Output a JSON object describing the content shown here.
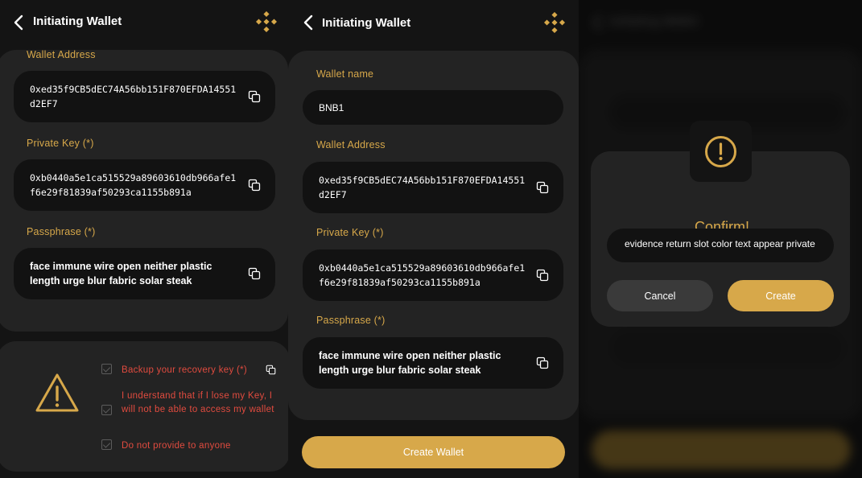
{
  "header": {
    "title": "Initiating Wallet"
  },
  "wallet": {
    "name_label": "Wallet name",
    "name_value": "BNB1",
    "address_label": "Wallet Address",
    "address_value": "0xed35f9CB5dEC74A56bb151F870EFDA14551d2EF7",
    "private_key_label": "Private Key (*)",
    "private_key_value": "0xb0440a5e1ca515529a89603610db966afe1f6e29f81839af50293ca1155b891a",
    "passphrase_label": "Passphrase (*)",
    "passphrase_value": "face immune wire open neither plastic length urge blur fabric solar steak"
  },
  "warnings": [
    "Backup your recovery key (*)",
    "I understand that if I lose my Key, I will not be able to access my wallet",
    "Do not provide to anyone"
  ],
  "create_wallet_label": "Create Wallet",
  "confirm": {
    "title": "Confirm!",
    "phrase_value": "evidence return slot color text appear private",
    "cancel_label": "Cancel",
    "create_label": "Create"
  },
  "colors": {
    "accent": "#d7a84a",
    "warning": "#e14b3f",
    "card": "#232323",
    "field": "#121212"
  },
  "icons": [
    "back-arrow-icon",
    "binance-logo-icon",
    "copy-icon",
    "warning-triangle-icon",
    "exclamation-icon"
  ]
}
